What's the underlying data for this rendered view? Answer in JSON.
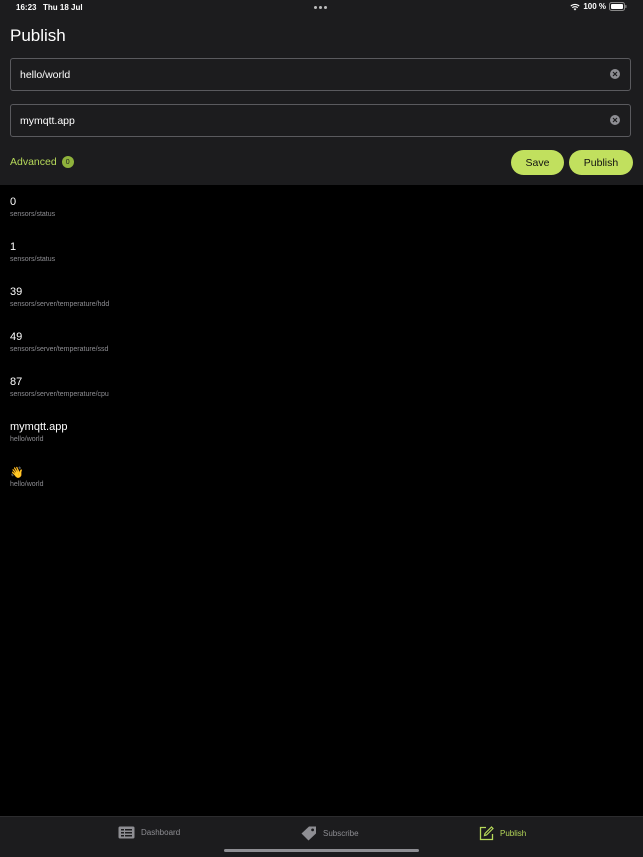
{
  "status_bar": {
    "time": "16:23",
    "date": "Thu 18 Jul",
    "battery": "100 %"
  },
  "header": {
    "title": "Publish"
  },
  "form": {
    "topic_value": "hello/world",
    "message_value": "mymqtt.app",
    "advanced_label": "Advanced",
    "advanced_badge": "0",
    "save_label": "Save",
    "publish_label": "Publish"
  },
  "messages": [
    {
      "value": "0",
      "topic": "sensors/status"
    },
    {
      "value": "1",
      "topic": "sensors/status"
    },
    {
      "value": "39",
      "topic": "sensors/server/temperature/hdd"
    },
    {
      "value": "49",
      "topic": "sensors/server/temperature/ssd"
    },
    {
      "value": "87",
      "topic": "sensors/server/temperature/cpu"
    },
    {
      "value": "mymqtt.app",
      "topic": "hello/world"
    },
    {
      "value": "👋",
      "topic": "hello/world"
    }
  ],
  "tab_bar": {
    "tabs": [
      {
        "label": "Dashboard",
        "icon": "dashboard-icon"
      },
      {
        "label": "Subscribe",
        "icon": "tag-icon"
      },
      {
        "label": "Publish",
        "icon": "compose-icon"
      }
    ],
    "active": "Publish"
  },
  "colors": {
    "accent": "#c1e05e",
    "accent_text": "#b6d95a",
    "background": "#000000",
    "panel": "#1c1c1e"
  }
}
